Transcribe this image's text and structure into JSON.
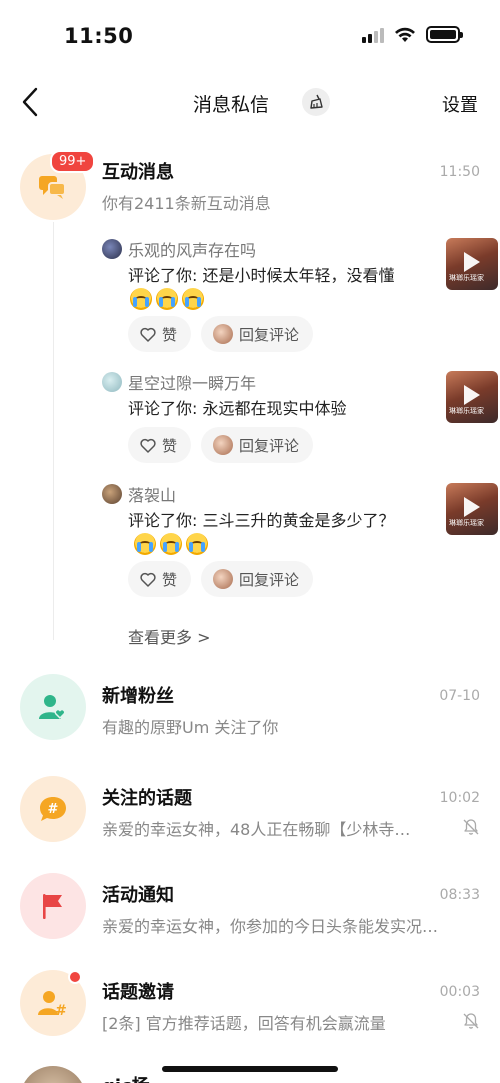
{
  "status_bar": {
    "time": "11:50"
  },
  "nav": {
    "title": "消息私信",
    "settings": "设置"
  },
  "interaction": {
    "badge": "99+",
    "title": "互动消息",
    "time": "11:50",
    "subtitle": "你有2411条新互动消息",
    "comments": [
      {
        "user": "乐观的风声存在吗",
        "text": "评论了你: 还是小时候太年轻，没看懂",
        "like": "赞",
        "reply": "回复评论",
        "thumb_caption": "琳瑯乐瑶家"
      },
      {
        "user": "星空过隙一瞬万年",
        "text": "评论了你: 永远都在现实中体验",
        "like": "赞",
        "reply": "回复评论",
        "thumb_caption": "琳瑯乐瑶家"
      },
      {
        "user": "落袈山",
        "text": "评论了你: 三斗三升的黄金是多少了？",
        "like": "赞",
        "reply": "回复评论",
        "thumb_caption": "琳瑯乐瑶家"
      }
    ],
    "see_more": "查看更多 >"
  },
  "rows": [
    {
      "title": "新增粉丝",
      "time": "07-10",
      "subtitle": "有趣的原野Um 关注了你",
      "icon": "follower-icon",
      "color": "#2fb58a"
    },
    {
      "title": "关注的话题",
      "time": "10:02",
      "subtitle": "亲爱的幸运女神，48人正在畅聊【少林寺…",
      "icon": "hashtag-icon",
      "color": "#f5a623"
    },
    {
      "title": "活动通知",
      "time": "08:33",
      "subtitle": "亲爱的幸运女神，你参加的今日头条能发实况…",
      "icon": "flag-icon",
      "color": "#e84545"
    },
    {
      "title": "话题邀请",
      "time": "00:03",
      "subtitle": "[2条] 官方推荐话题，回答有机会赢流量",
      "icon": "topic-invite-icon",
      "color": "#f5a623"
    }
  ],
  "partial_row": {
    "title": "gjc杨"
  }
}
